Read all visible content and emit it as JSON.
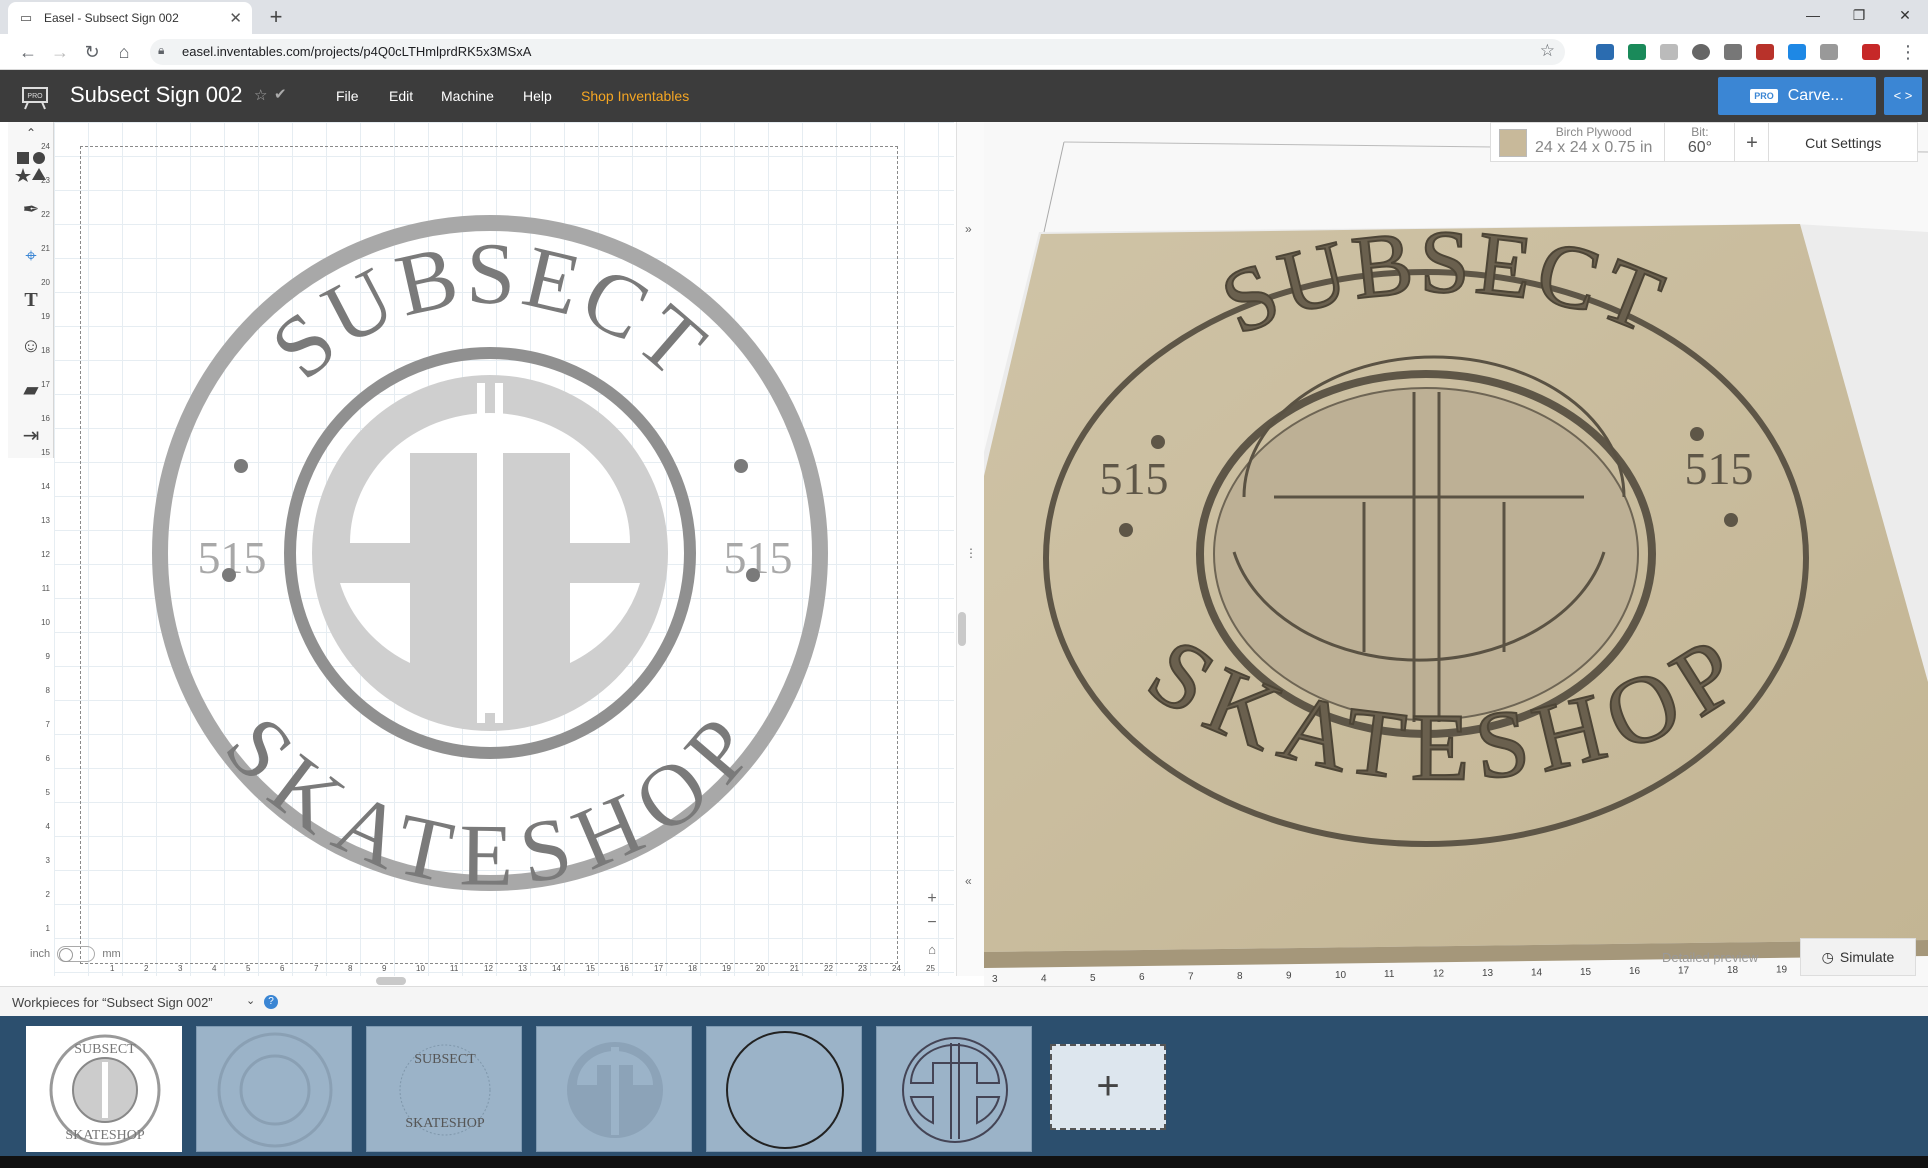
{
  "browser": {
    "tab_title": "Easel - Subsect Sign 002",
    "tab_close": "✕",
    "new_tab": "+",
    "url": "easel.inventables.com/projects/p4Q0cLTHmlprdRK5x3MSxA",
    "window_controls": [
      "—",
      "❐",
      "✕"
    ]
  },
  "app": {
    "logo_text": "PRO",
    "project_title": "Subsect Sign 002",
    "menus": [
      "File",
      "Edit",
      "Machine",
      "Help"
    ],
    "shop_link": "Shop Inventables",
    "carve_badge": "PRO",
    "carve_label": "Carve...",
    "accent_color": "#3b86d4",
    "shop_color": "#f5a623"
  },
  "toolbar": {
    "icons": [
      "collapse-icon",
      "shapes-icon",
      "pen-icon",
      "target-icon",
      "text-icon",
      "emoji-icon",
      "apps-icon",
      "import-icon"
    ],
    "text_tool_label": "T"
  },
  "canvas": {
    "y_ruler": [
      "24",
      "23",
      "22",
      "21",
      "20",
      "19",
      "18",
      "17",
      "16",
      "15",
      "14",
      "13",
      "12",
      "11",
      "10",
      "9",
      "8",
      "7",
      "6",
      "5",
      "4",
      "3",
      "2",
      "1"
    ],
    "x_ruler": [
      "1",
      "2",
      "3",
      "4",
      "5",
      "6",
      "7",
      "8",
      "9",
      "10",
      "11",
      "12",
      "13",
      "14",
      "15",
      "16",
      "17",
      "18",
      "19",
      "20",
      "21",
      "22",
      "23",
      "24",
      "25"
    ],
    "unit_left": "inch",
    "unit_right": "mm",
    "design": {
      "top_text": "SUBSECT",
      "bottom_text": "SKATESHOP",
      "side_left": "515",
      "side_right": "515"
    }
  },
  "preview": {
    "material_name": "Birch Plywood",
    "material_dims": "24 x 24 x 0.75 in",
    "bit_label": "Bit:",
    "bit_value": "60°",
    "add_bit": "+",
    "cut_settings": "Cut Settings",
    "x_ruler": [
      "3",
      "4",
      "5",
      "6",
      "7",
      "8",
      "9",
      "10",
      "11",
      "12",
      "13",
      "14",
      "15",
      "16",
      "17",
      "18",
      "19"
    ],
    "detailed_preview": "Detailed preview",
    "simulate": "Simulate"
  },
  "workpieces": {
    "title": "Workpieces for “Subsect Sign 002”",
    "help": "?",
    "add_label": "+"
  }
}
